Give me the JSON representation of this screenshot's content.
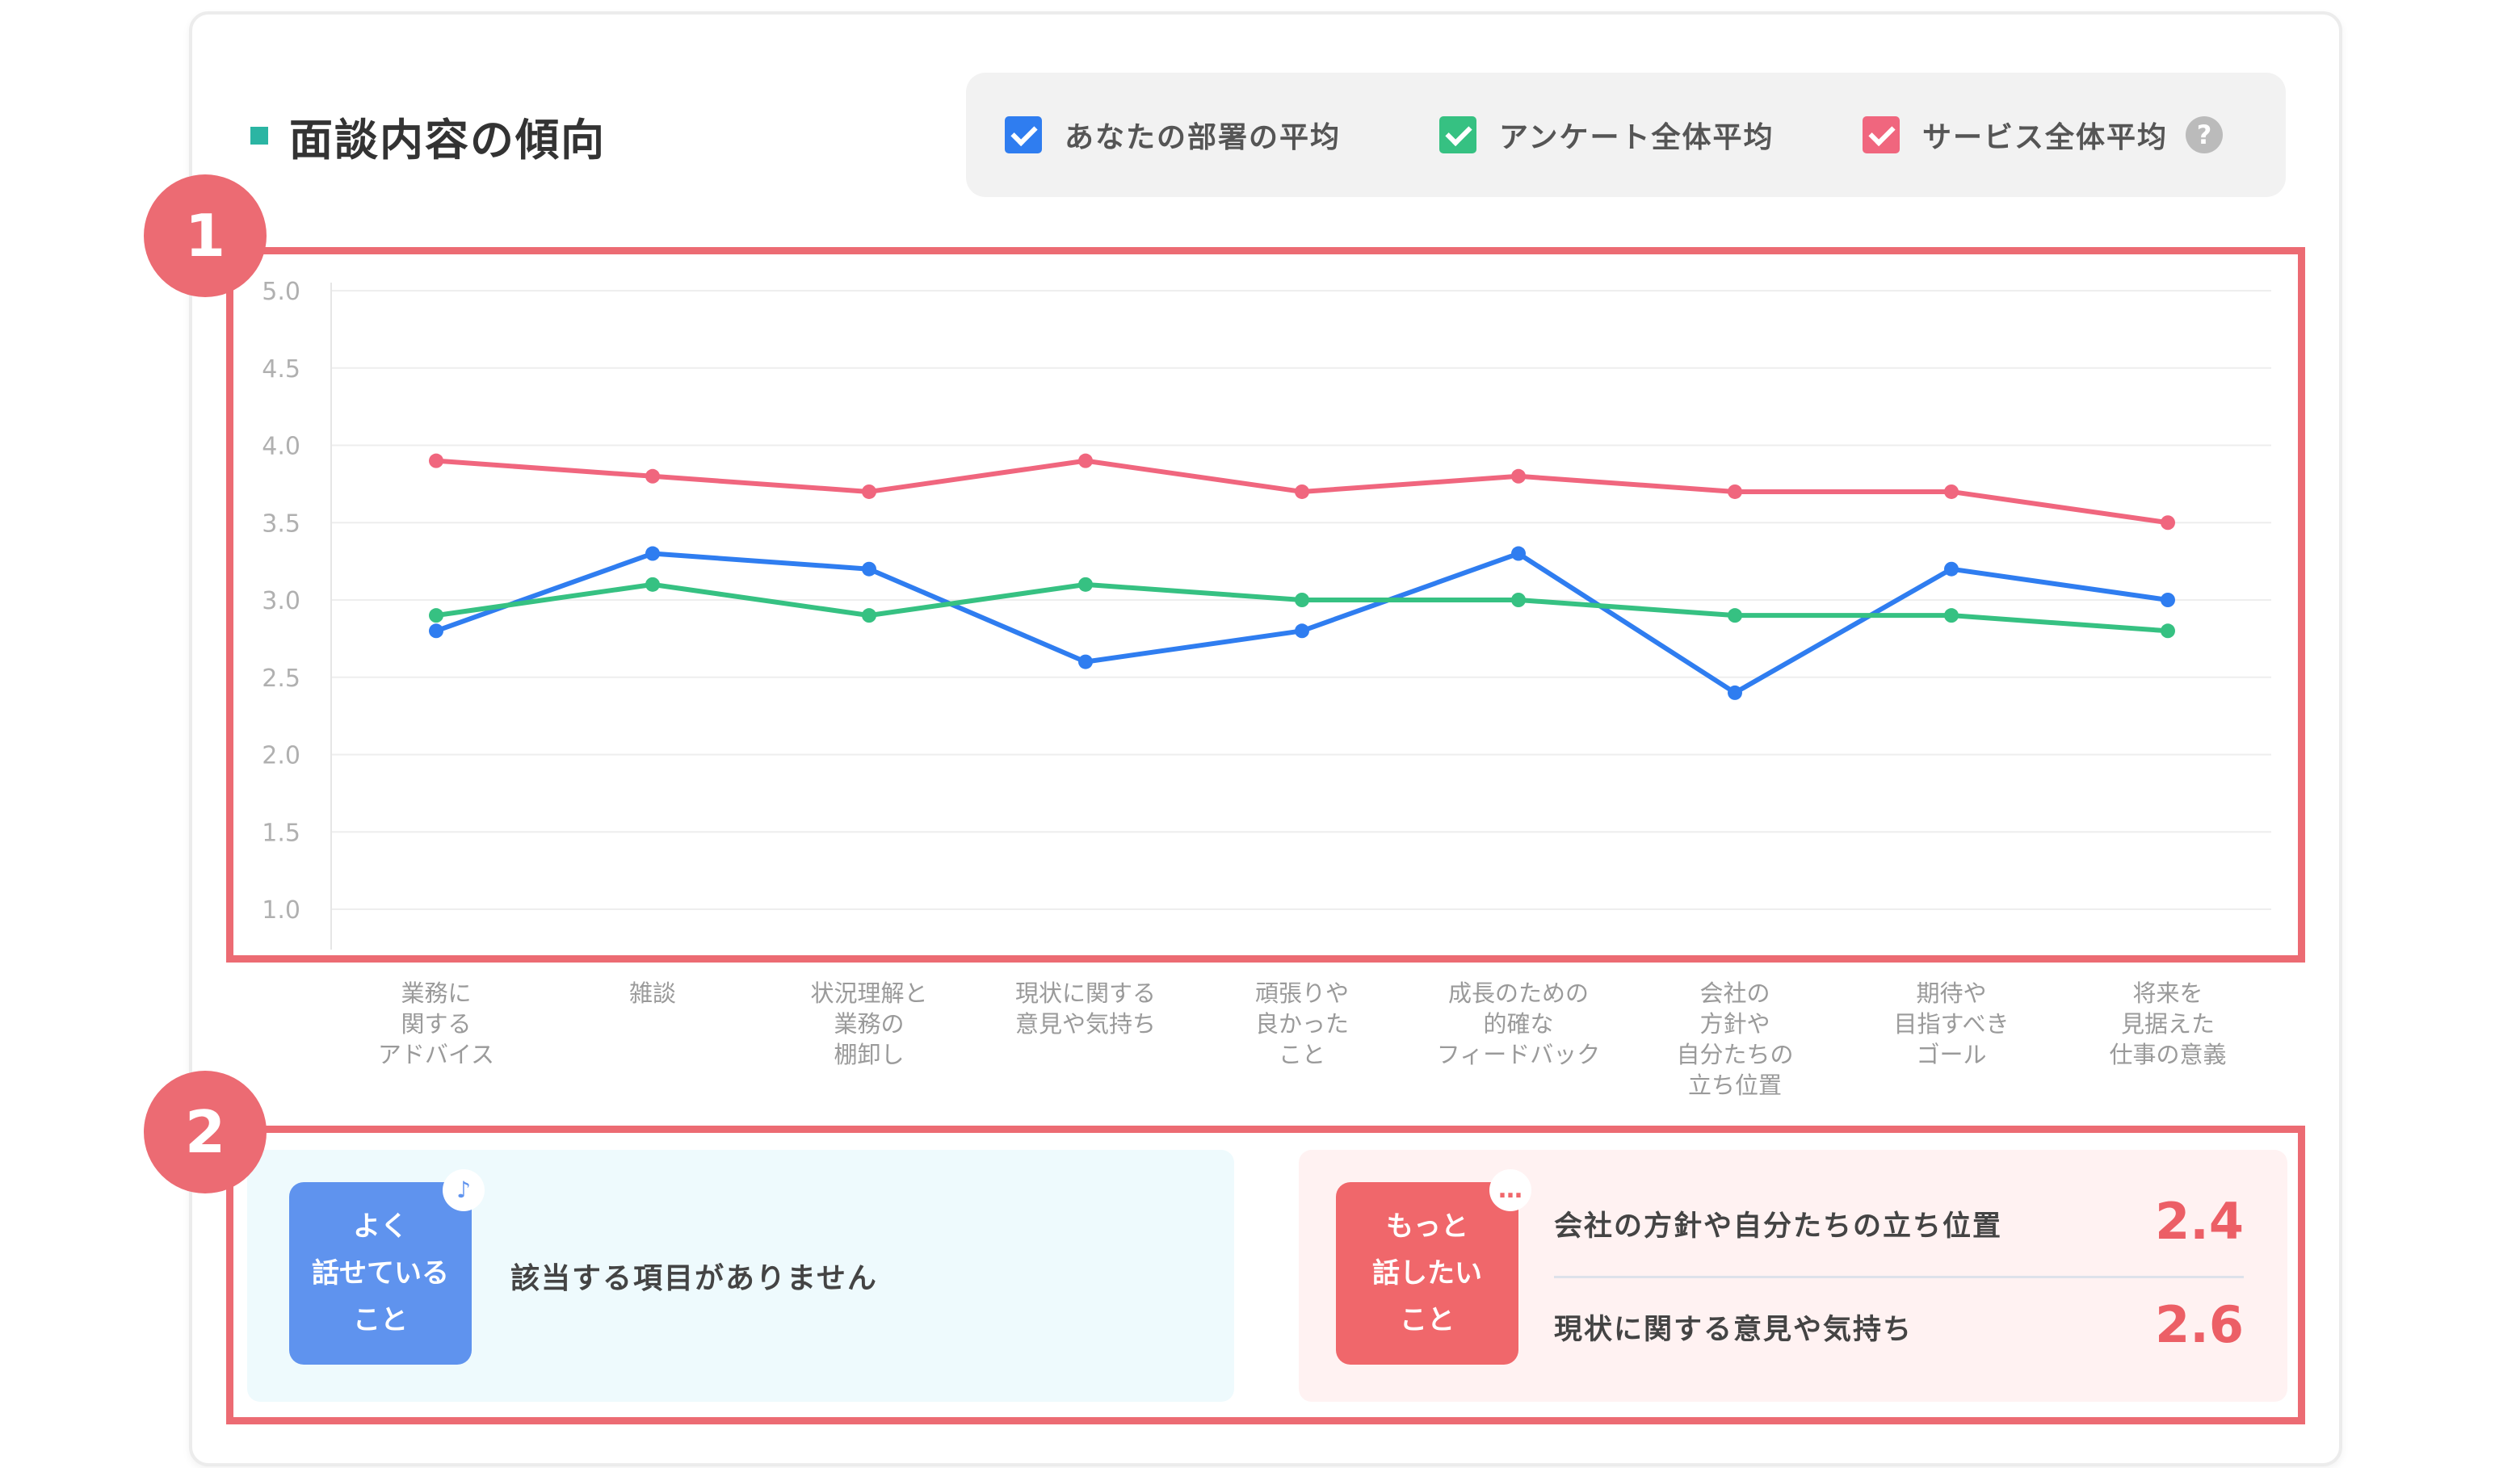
{
  "title": "面談内容の傾向",
  "legend": {
    "items": [
      {
        "label": "あなたの部署の平均",
        "color": "#2f7df0"
      },
      {
        "label": "アンケート全体平均",
        "color": "#36c182"
      },
      {
        "label": "サービス全体平均",
        "color": "#f0667e"
      }
    ],
    "help_icon": "question-circle-icon",
    "help_text": "?"
  },
  "annotations": {
    "badge1": "1",
    "badge2": "2"
  },
  "chart_data": {
    "type": "line",
    "yticks": [
      "5.0",
      "4.5",
      "4.0",
      "3.5",
      "3.0",
      "2.5",
      "2.0",
      "1.5",
      "1.0"
    ],
    "ylim": [
      1.0,
      5.0
    ],
    "grid": true,
    "categories": [
      [
        "業務に",
        "関する",
        "アドバイス"
      ],
      [
        "雑談"
      ],
      [
        "状況理解と",
        "業務の",
        "棚卸し"
      ],
      [
        "現状に関する",
        "意見や気持ち"
      ],
      [
        "頑張りや",
        "良かった",
        "こと"
      ],
      [
        "成長のための",
        "的確な",
        "フィードバック"
      ],
      [
        "会社の",
        "方針や",
        "自分たちの",
        "立ち位置"
      ],
      [
        "期待や",
        "目指すべき",
        "ゴール"
      ],
      [
        "将来を",
        "見据えた",
        "仕事の意義"
      ]
    ],
    "series": [
      {
        "name": "あなたの部署の平均",
        "color": "#2f7df0",
        "values": [
          2.8,
          3.3,
          3.2,
          2.6,
          2.8,
          3.3,
          2.4,
          3.2,
          3.0
        ]
      },
      {
        "name": "アンケート全体平均",
        "color": "#36c182",
        "values": [
          2.9,
          3.1,
          2.9,
          3.1,
          3.0,
          3.0,
          2.9,
          2.9,
          2.8
        ]
      },
      {
        "name": "サービス全体平均",
        "color": "#f0667e",
        "values": [
          3.9,
          3.8,
          3.7,
          3.9,
          3.7,
          3.8,
          3.7,
          3.7,
          3.5
        ]
      }
    ]
  },
  "good": {
    "tag_lines": [
      "よく",
      "話せている",
      "こと"
    ],
    "icon": "music-note-icon",
    "icon_glyph": "♪",
    "empty_text": "該当する項目がありません"
  },
  "more": {
    "tag_lines": [
      "もっと",
      "話したい",
      "こと"
    ],
    "icon": "speech-bubble-icon",
    "icon_glyph": "…",
    "items": [
      {
        "label": "会社の方針や自分たちの立ち位置",
        "score": "2.4"
      },
      {
        "label": "現状に関する意見や気持ち",
        "score": "2.6"
      }
    ]
  }
}
